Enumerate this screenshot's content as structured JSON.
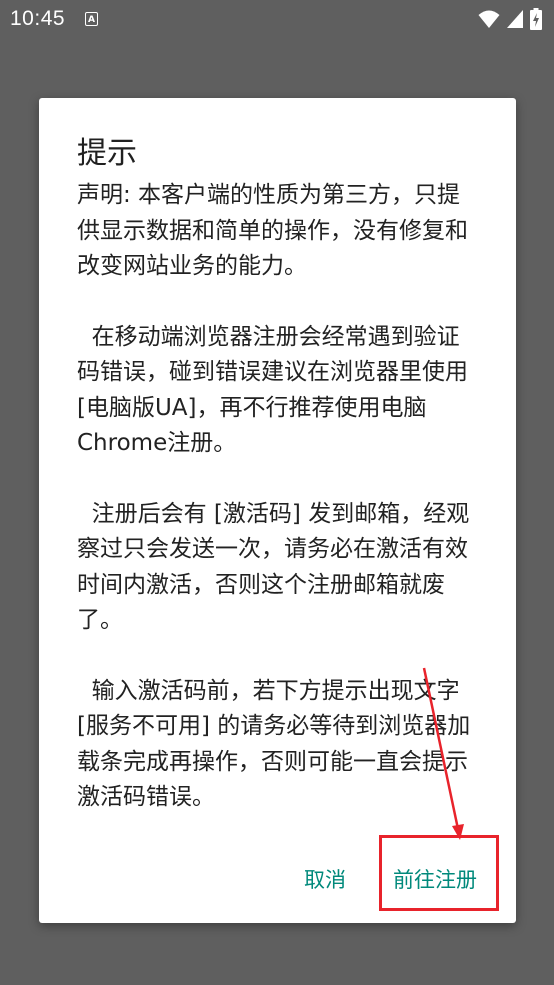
{
  "status_bar": {
    "time": "10:45",
    "notification_glyph": "A",
    "icons": [
      "wifi-icon",
      "signal-icon",
      "battery-charging-icon"
    ]
  },
  "dialog": {
    "title": "提示",
    "paragraphs": [
      "声明: 本客户端的性质为第三方，只提供显示数据和简单的操作，没有修复和改变网站业务的能力。",
      "  在移动端浏览器注册会经常遇到验证码错误，碰到错误建议在浏览器里使用 [电脑版UA]，再不行推荐使用电脑Chrome注册。",
      "  注册后会有 [激活码] 发到邮箱，经观察过只会发送一次，请务必在激活有效时间内激活，否则这个注册邮箱就废了。",
      "  输入激活码前，若下方提示出现文字 [服务不可用] 的请务必等待到浏览器加载条完成再操作，否则可能一直会提示激活码错误。"
    ],
    "buttons": {
      "cancel": "取消",
      "register": "前往注册"
    }
  },
  "colors": {
    "accent": "#00897b",
    "annotation": "#e8232b",
    "scrim": "#5f5f5f"
  }
}
